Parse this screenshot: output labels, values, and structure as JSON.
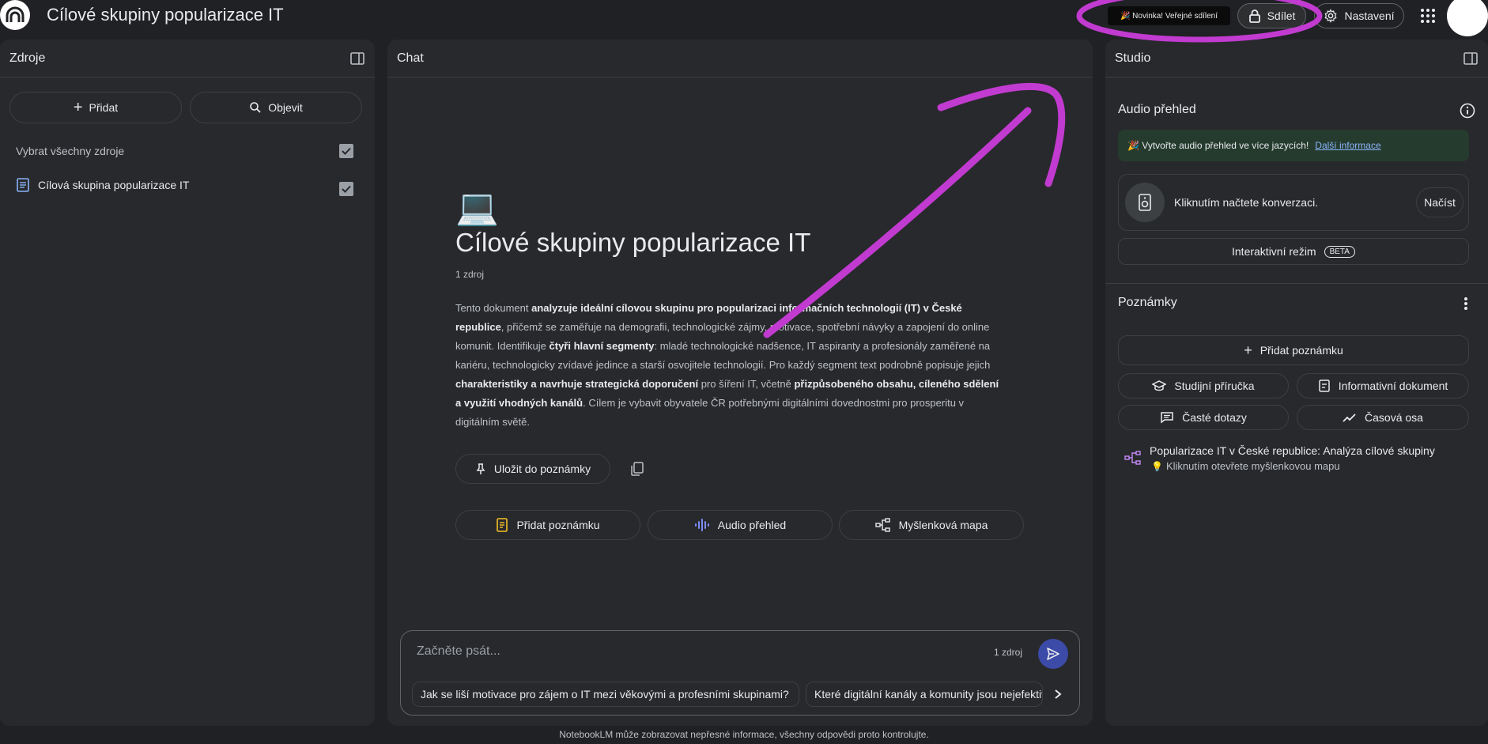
{
  "header": {
    "notebook_title": "Cílové skupiny popularizace IT",
    "news_pill": "🎉 Novinka! Veřejné sdílení",
    "share_label": "Sdílet",
    "settings_label": "Nastavení"
  },
  "sources": {
    "title": "Zdroje",
    "add_label": "Přidat",
    "discover_label": "Objevit",
    "select_all_label": "Vybrat všechny zdroje",
    "items": [
      {
        "label": "Cílová skupina popularizace IT"
      }
    ]
  },
  "chat": {
    "title": "Chat",
    "emoji": "💻",
    "notebook_title": "Cílové skupiny popularizace IT",
    "source_count": "1 zdroj",
    "summary": {
      "p1": "Tento dokument ",
      "b1": "analyzuje ideální cílovou skupinu pro popularizaci informačních technologií (IT) v České republice",
      "p2": ", přičemž se zaměřuje na demografii, technologické zájmy, motivace, spotřební návyky a zapojení do online komunit. Identifikuje ",
      "b2": "čtyři hlavní segmenty",
      "p3": ": mladé technologické nadšence, IT aspiranty a profesionály zaměřené na kariéru, technologicky zvídavé jedince a starší osvojitele technologií. Pro každý segment text podrobně popisuje jejich ",
      "b3": "charakteristiky a navrhuje strategická doporučení",
      "p4": " pro šíření IT, včetně ",
      "b4": "přizpůsobeného obsahu, cíleného sdělení a využití vhodných kanálů",
      "p5": ". Cílem je vybavit obyvatele ČR potřebnými digitálními dovednostmi pro prosperitu v digitálním světě."
    },
    "save_note_label": "Uložit do poznámky",
    "actions": {
      "add_note": "Přidat poznámku",
      "audio_overview": "Audio přehled",
      "mind_map": "Myšlenková mapa"
    },
    "composer": {
      "placeholder": "Začněte psát...",
      "source_count": "1 zdroj"
    },
    "suggestions": [
      "Jak se liší motivace pro zájem o IT mezi věkovými a profesními skupinami?",
      "Které digitální kanály a komunity jsou nejefektivnější"
    ],
    "footer_note": "NotebookLM může zobrazovat nepřesné informace, všechny odpovědi proto kontrolujte."
  },
  "studio": {
    "title": "Studio",
    "audio_title": "Audio přehled",
    "banner_text": "🎉  Vytvořte audio přehled ve více jazycích!",
    "banner_link": "Další informace",
    "audio_card_text": "Kliknutím načtete konverzaci.",
    "load_label": "Načíst",
    "interactive_label": "Interaktivní režim",
    "beta_label": "BETA",
    "notes_title": "Poznámky",
    "add_note_label": "Přidat poznámku",
    "tools": {
      "study_guide": "Studijní příručka",
      "briefing_doc": "Informativní dokument",
      "faq": "Časté dotazy",
      "timeline": "Časová osa"
    },
    "note_items": [
      {
        "title": "Popularizace IT v České republice: Analýza cílové skupiny",
        "subtitle": "Kliknutím otevřete myšlenkovou mapu"
      }
    ]
  },
  "colors": {
    "background": "#202124",
    "panel": "#28292c",
    "accent": "#3c4aa8",
    "annotation": "#c13bd0"
  }
}
